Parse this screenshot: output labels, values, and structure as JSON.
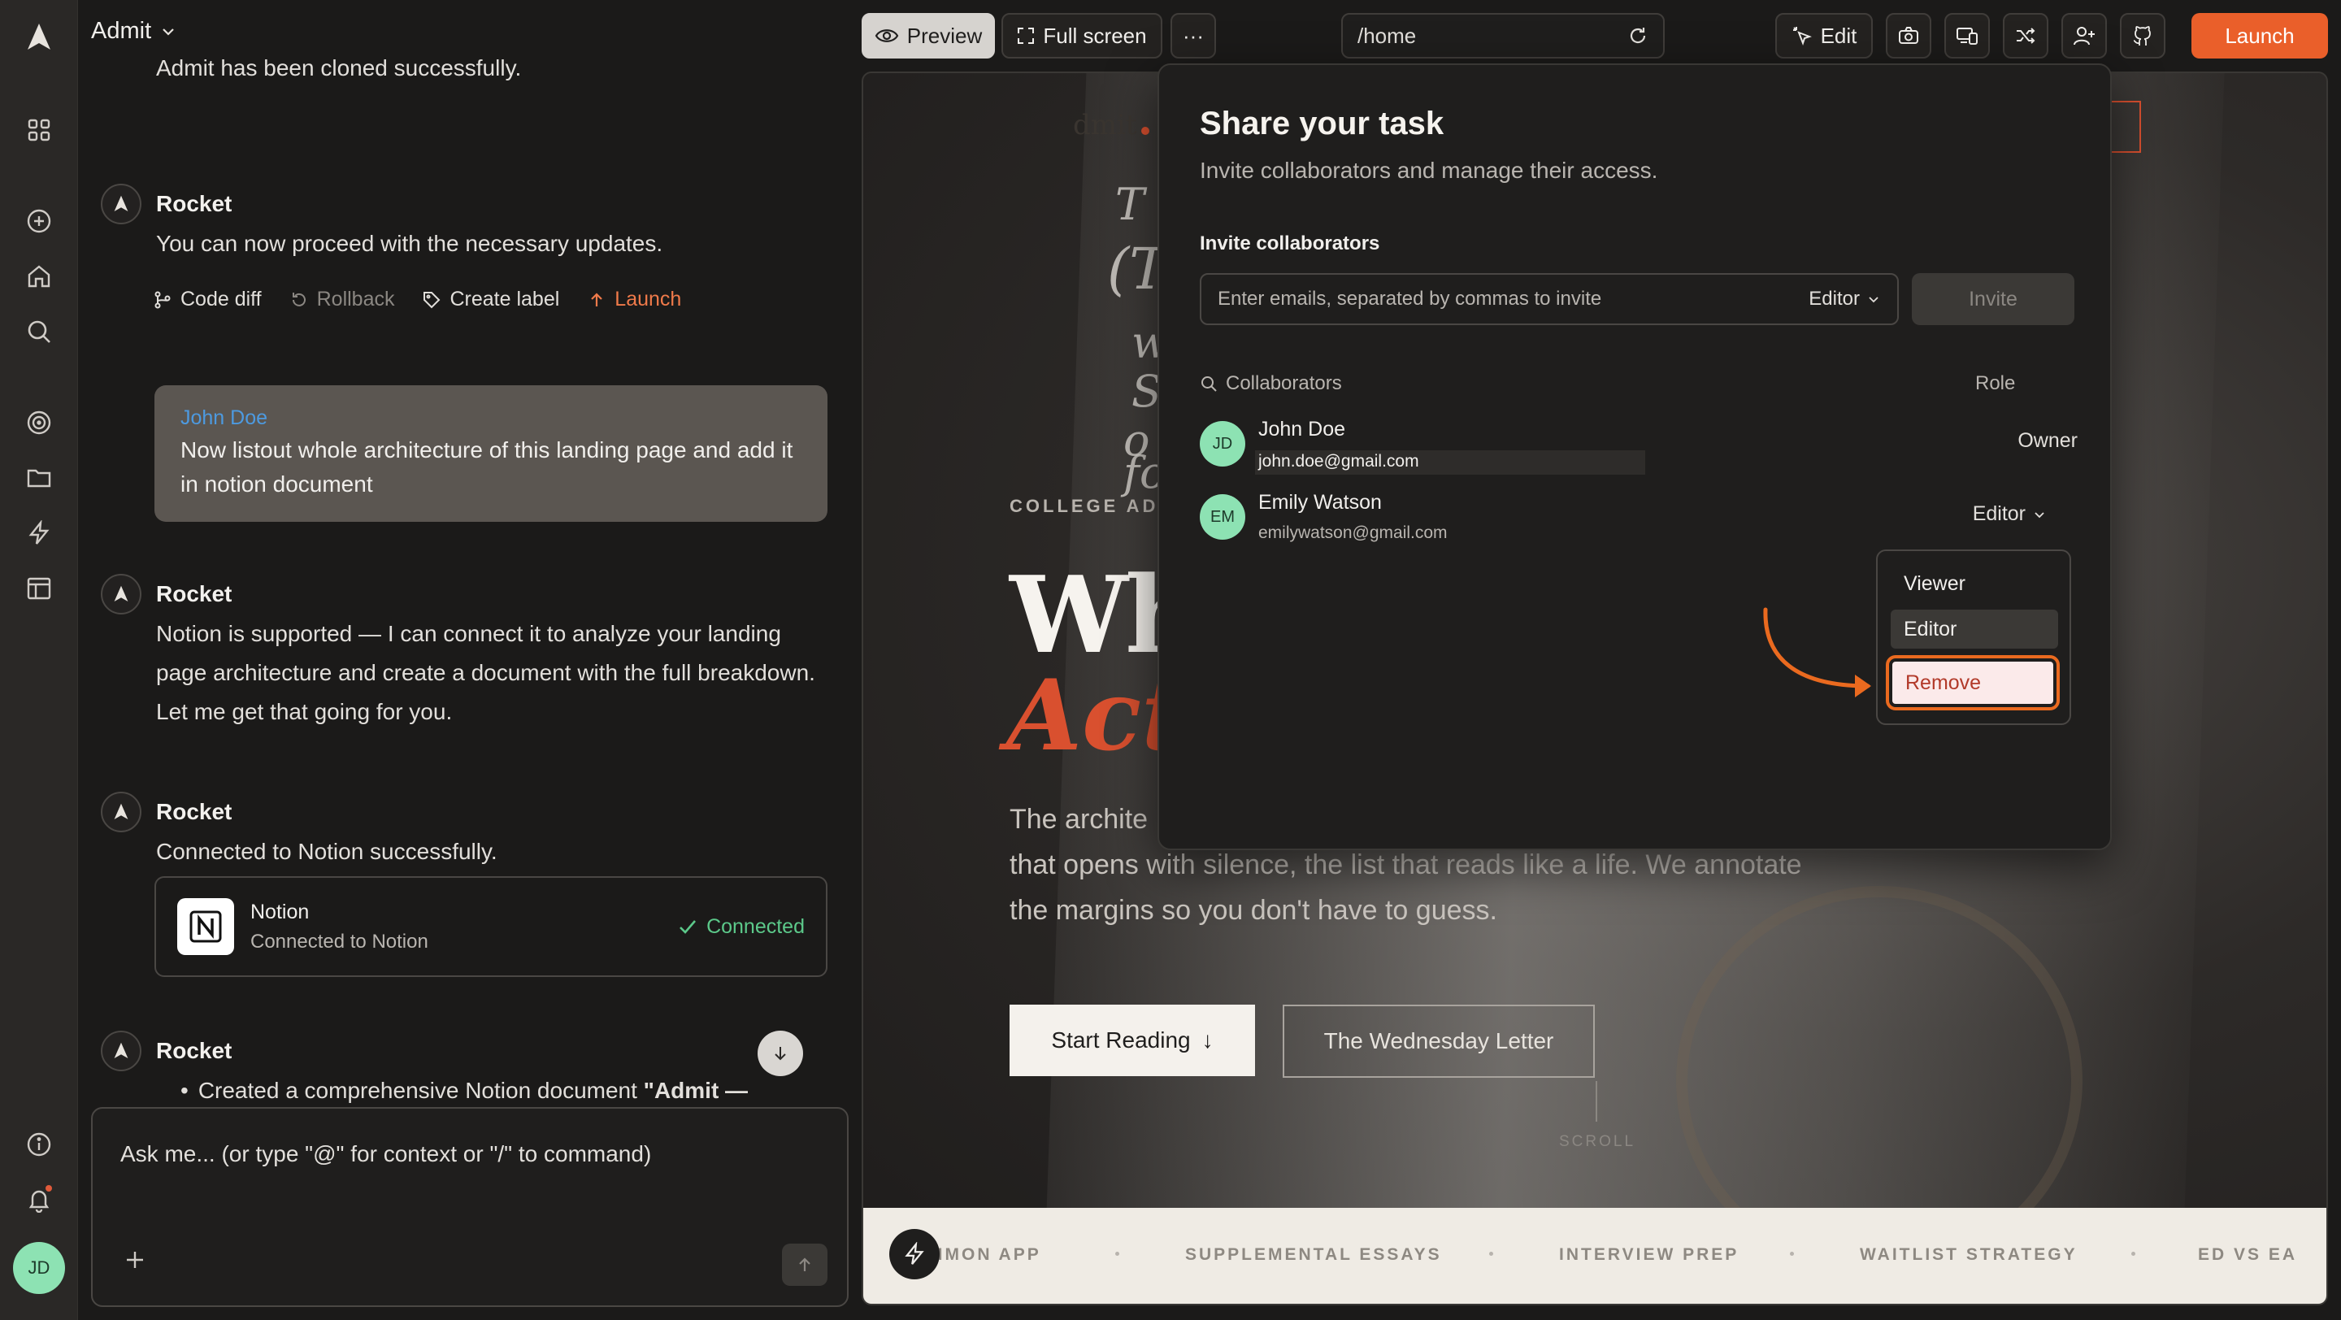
{
  "app": {
    "project_name": "Admit"
  },
  "toolbar": {
    "preview_label": "Preview",
    "fullscreen_label": "Full screen",
    "more_label": "···",
    "url": "/home",
    "edit_label": "Edit",
    "launch_label": "Launch"
  },
  "chat": {
    "partial_top": "Admit has been cloned successfully.",
    "msg1": {
      "author": "Rocket",
      "text": "You can now proceed with the necessary updates."
    },
    "actions": {
      "code_diff": "Code diff",
      "rollback": "Rollback",
      "create_label": "Create label",
      "launch": "Launch"
    },
    "user": {
      "name": "John Doe",
      "text": "Now listout whole architecture of this landing page and add it in notion document"
    },
    "msg2": {
      "author": "Rocket",
      "text": "Notion is supported — I can connect it to analyze your landing page architecture and create a document with the full breakdown. Let me get that going for you."
    },
    "msg3": {
      "author": "Rocket",
      "text": "Connected to Notion successfully."
    },
    "notion_card": {
      "title": "Notion",
      "subtitle": "Connected to Notion",
      "status": "Connected"
    },
    "msg4": {
      "author": "Rocket",
      "bullet_prefix": "Created a comprehensive Notion document ",
      "bullet_bold": "\"Admit —"
    },
    "composer_placeholder": "Ask me... (or type \"@\" for context or \"/\" to command)"
  },
  "rail": {
    "user_initials": "JD"
  },
  "preview": {
    "logo": "dmit",
    "eyebrow": "COLLEGE ADM",
    "headline_1": "Wh",
    "headline_2": "Act",
    "lead_1": "The archite",
    "lead_2": "that opens with silence, the list that reads like a life. We annotate",
    "lead_3": "the margins so you don't have to guess.",
    "btn_primary": "Start Reading",
    "btn_primary_arrow": "↓",
    "btn_secondary": "The Wednesday Letter",
    "scroll_label": "SCROLL",
    "ticker": [
      "MMON APP",
      "SUPPLEMENTAL ESSAYS",
      "INTERVIEW PREP",
      "WAITLIST STRATEGY",
      "ED VS EA"
    ]
  },
  "share_modal": {
    "title": "Share your task",
    "subtitle": "Invite collaborators and manage their access.",
    "invite_label": "Invite collaborators",
    "input_placeholder": "Enter emails, separated by commas to invite",
    "input_role": "Editor",
    "invite_button": "Invite",
    "collaborators_label": "Collaborators",
    "role_header": "Role",
    "people": [
      {
        "initials": "JD",
        "name": "John Doe",
        "email": "john.doe@gmail.com",
        "role": "Owner"
      },
      {
        "initials": "EM",
        "name": "Emily Watson",
        "email": "emilywatson@gmail.com",
        "role": "Editor"
      }
    ],
    "role_menu": {
      "viewer": "Viewer",
      "editor": "Editor",
      "remove": "Remove"
    }
  },
  "colors": {
    "accent": "#ea5f2a",
    "success": "#5cc98a",
    "link": "#4d9ae0",
    "highlight": "#ea6a1f"
  }
}
